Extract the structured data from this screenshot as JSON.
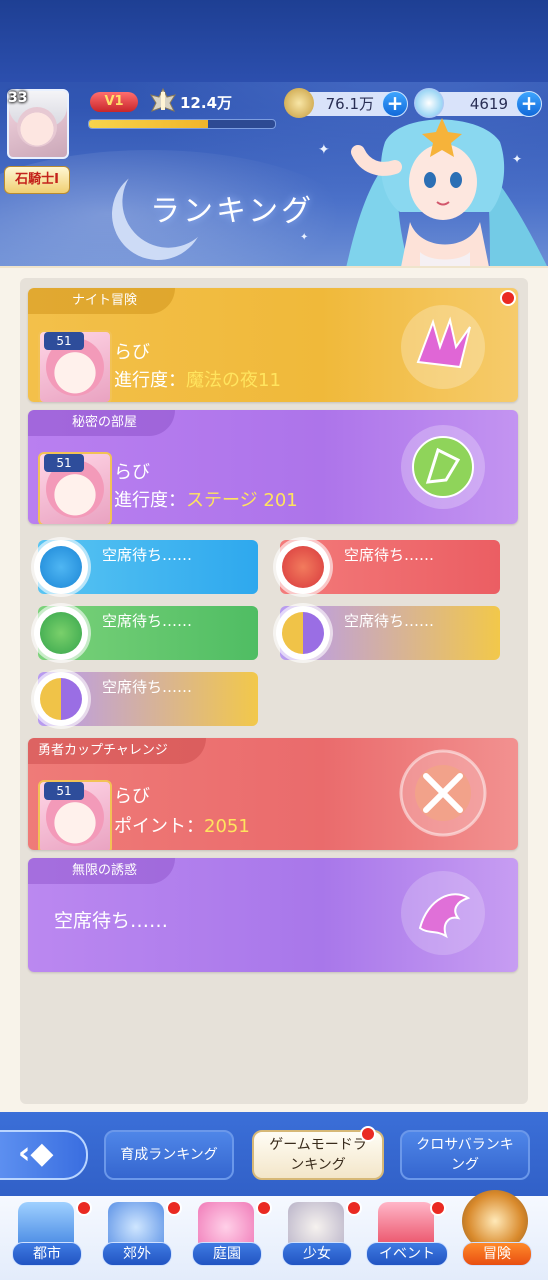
{
  "header": {
    "player_level": "33",
    "player_title": "石騎士Ⅰ",
    "vip": "V1",
    "power": "12.4万",
    "exp_fraction": 0.64,
    "gold": "76.1万",
    "gems": "4619",
    "page_title": "ランキング"
  },
  "cards": {
    "knight": {
      "tab": "ナイト冒険",
      "level": "51",
      "name": "らび",
      "progress_label": "進行度：",
      "progress_value": "魔法の夜11"
    },
    "secret": {
      "tab": "秘密の部屋",
      "level": "51",
      "name": "らび",
      "progress_label": "進行度：",
      "progress_value": "ステージ 201"
    },
    "elements": [
      {
        "label": "空席待ち……",
        "icon": "water-drop-icon"
      },
      {
        "label": "空席待ち……",
        "icon": "fire-icon"
      },
      {
        "label": "空席待ち……",
        "icon": "wind-tornado-icon"
      },
      {
        "label": "空席待ち……",
        "icon": "light-dark-icon"
      },
      {
        "label": "空席待ち……",
        "icon": "light-dark-icon"
      }
    ],
    "cup": {
      "tab": "勇者カップチャレンジ",
      "level": "51",
      "name": "らび",
      "points_label": "ポイント：",
      "points_value": "2051"
    },
    "infinite": {
      "tab": "無限の誘惑",
      "empty_text": "空席待ち……"
    }
  },
  "mode_tabs": {
    "growth": "育成ランキング",
    "gamemode_line1": "ゲームモードラ",
    "gamemode_line2": "ンキング",
    "cross_line1": "クロサバランキ",
    "cross_line2": "ング"
  },
  "nav": [
    "都市",
    "郊外",
    "庭園",
    "少女",
    "イベント",
    "冒険"
  ],
  "colors": {
    "knight": "#f1bd3e",
    "secret": "#b57bea",
    "cup": "#ee7774",
    "infinite": "#b57bea"
  }
}
